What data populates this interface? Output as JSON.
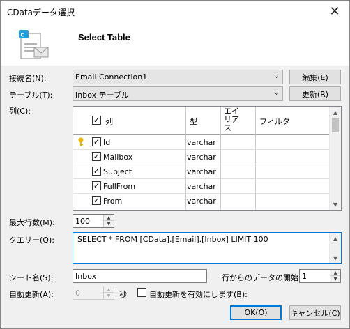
{
  "window": {
    "title": "CDataデータ選択",
    "close_label": "✕"
  },
  "header": {
    "heading": "Select Table",
    "icon": "document-mail-icon"
  },
  "connection": {
    "label": "接続名(N):",
    "value": "Email.Connection1",
    "edit_button": "編集(E)"
  },
  "table": {
    "label": "テーブル(T):",
    "value": "Inbox テーブル",
    "refresh_button": "更新(R)"
  },
  "columns": {
    "label": "列(C):",
    "headers": {
      "column": "列",
      "type": "型",
      "alias": "エイリアス",
      "filter": "フィルタ"
    },
    "rows": [
      {
        "key": true,
        "checked": true,
        "name": "Id",
        "type": "varchar"
      },
      {
        "key": false,
        "checked": true,
        "name": "Mailbox",
        "type": "varchar"
      },
      {
        "key": false,
        "checked": true,
        "name": "Subject",
        "type": "varchar"
      },
      {
        "key": false,
        "checked": true,
        "name": "FullFrom",
        "type": "varchar"
      },
      {
        "key": false,
        "checked": true,
        "name": "From",
        "type": "varchar"
      }
    ]
  },
  "max_rows": {
    "label": "最大行数(M):",
    "value": "100"
  },
  "query": {
    "label": "クエリー(Q):",
    "value": "SELECT * FROM [CData].[Email].[Inbox] LIMIT 100"
  },
  "sheet": {
    "label": "シート名(S):",
    "value": "Inbox",
    "start_row_label": "行からのデータの開始",
    "start_row_value": "1"
  },
  "auto_refresh": {
    "label": "自動更新(A):",
    "value": "0",
    "unit": "秒",
    "enable_label": "自動更新を有効にします(B):",
    "enabled": false
  },
  "buttons": {
    "ok": "OK(O)",
    "cancel": "キャンセル(C)"
  },
  "colors": {
    "accent": "#0078d7",
    "key_icon": "#e8b400"
  }
}
